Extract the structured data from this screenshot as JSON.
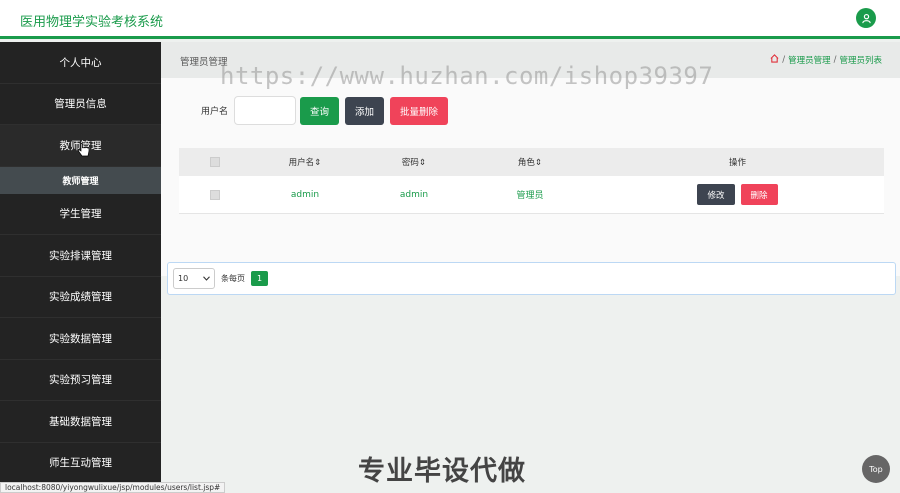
{
  "header": {
    "app_title": "医用物理学实验考核系统",
    "user_icon": "user-icon"
  },
  "sidebar": {
    "items": [
      {
        "label": "个人中心"
      },
      {
        "label": "管理员信息"
      },
      {
        "label": "教师管理"
      },
      {
        "label": "学生管理"
      },
      {
        "label": "实验排课管理"
      },
      {
        "label": "实验成绩管理"
      },
      {
        "label": "实验数据管理"
      },
      {
        "label": "实验预习管理"
      },
      {
        "label": "基础数据管理"
      },
      {
        "label": "师生互动管理"
      }
    ],
    "active_sub": "教师管理"
  },
  "page": {
    "title": "管理员管理",
    "breadcrumbs": [
      "管理员管理",
      "管理员列表"
    ],
    "home_icon": "home-icon"
  },
  "watermark": "https://www.huzhan.com/ishop39397",
  "search": {
    "label": "用户名",
    "value": "",
    "query_label": "查询",
    "add_label": "添加",
    "batch_delete_label": "批量删除"
  },
  "table": {
    "headers": {
      "username": "用户名",
      "password": "密码",
      "role": "角色",
      "actions": "操作"
    },
    "rows": [
      {
        "username": "admin",
        "password": "admin",
        "role": "管理员",
        "edit_label": "修改",
        "delete_label": "删除"
      }
    ]
  },
  "pager": {
    "page_size": "10",
    "per_page_label": "条每页",
    "current_page": "1"
  },
  "banner": "专业毕设代做",
  "top_button": "Top",
  "status_url": "localhost:8080/yiyongwulixue/jsp/modules/users/list.jsp#",
  "colors": {
    "accent": "#1a9b4b",
    "danger": "#f0435a",
    "dark_button": "#3d4450",
    "sidebar": "#232323"
  }
}
